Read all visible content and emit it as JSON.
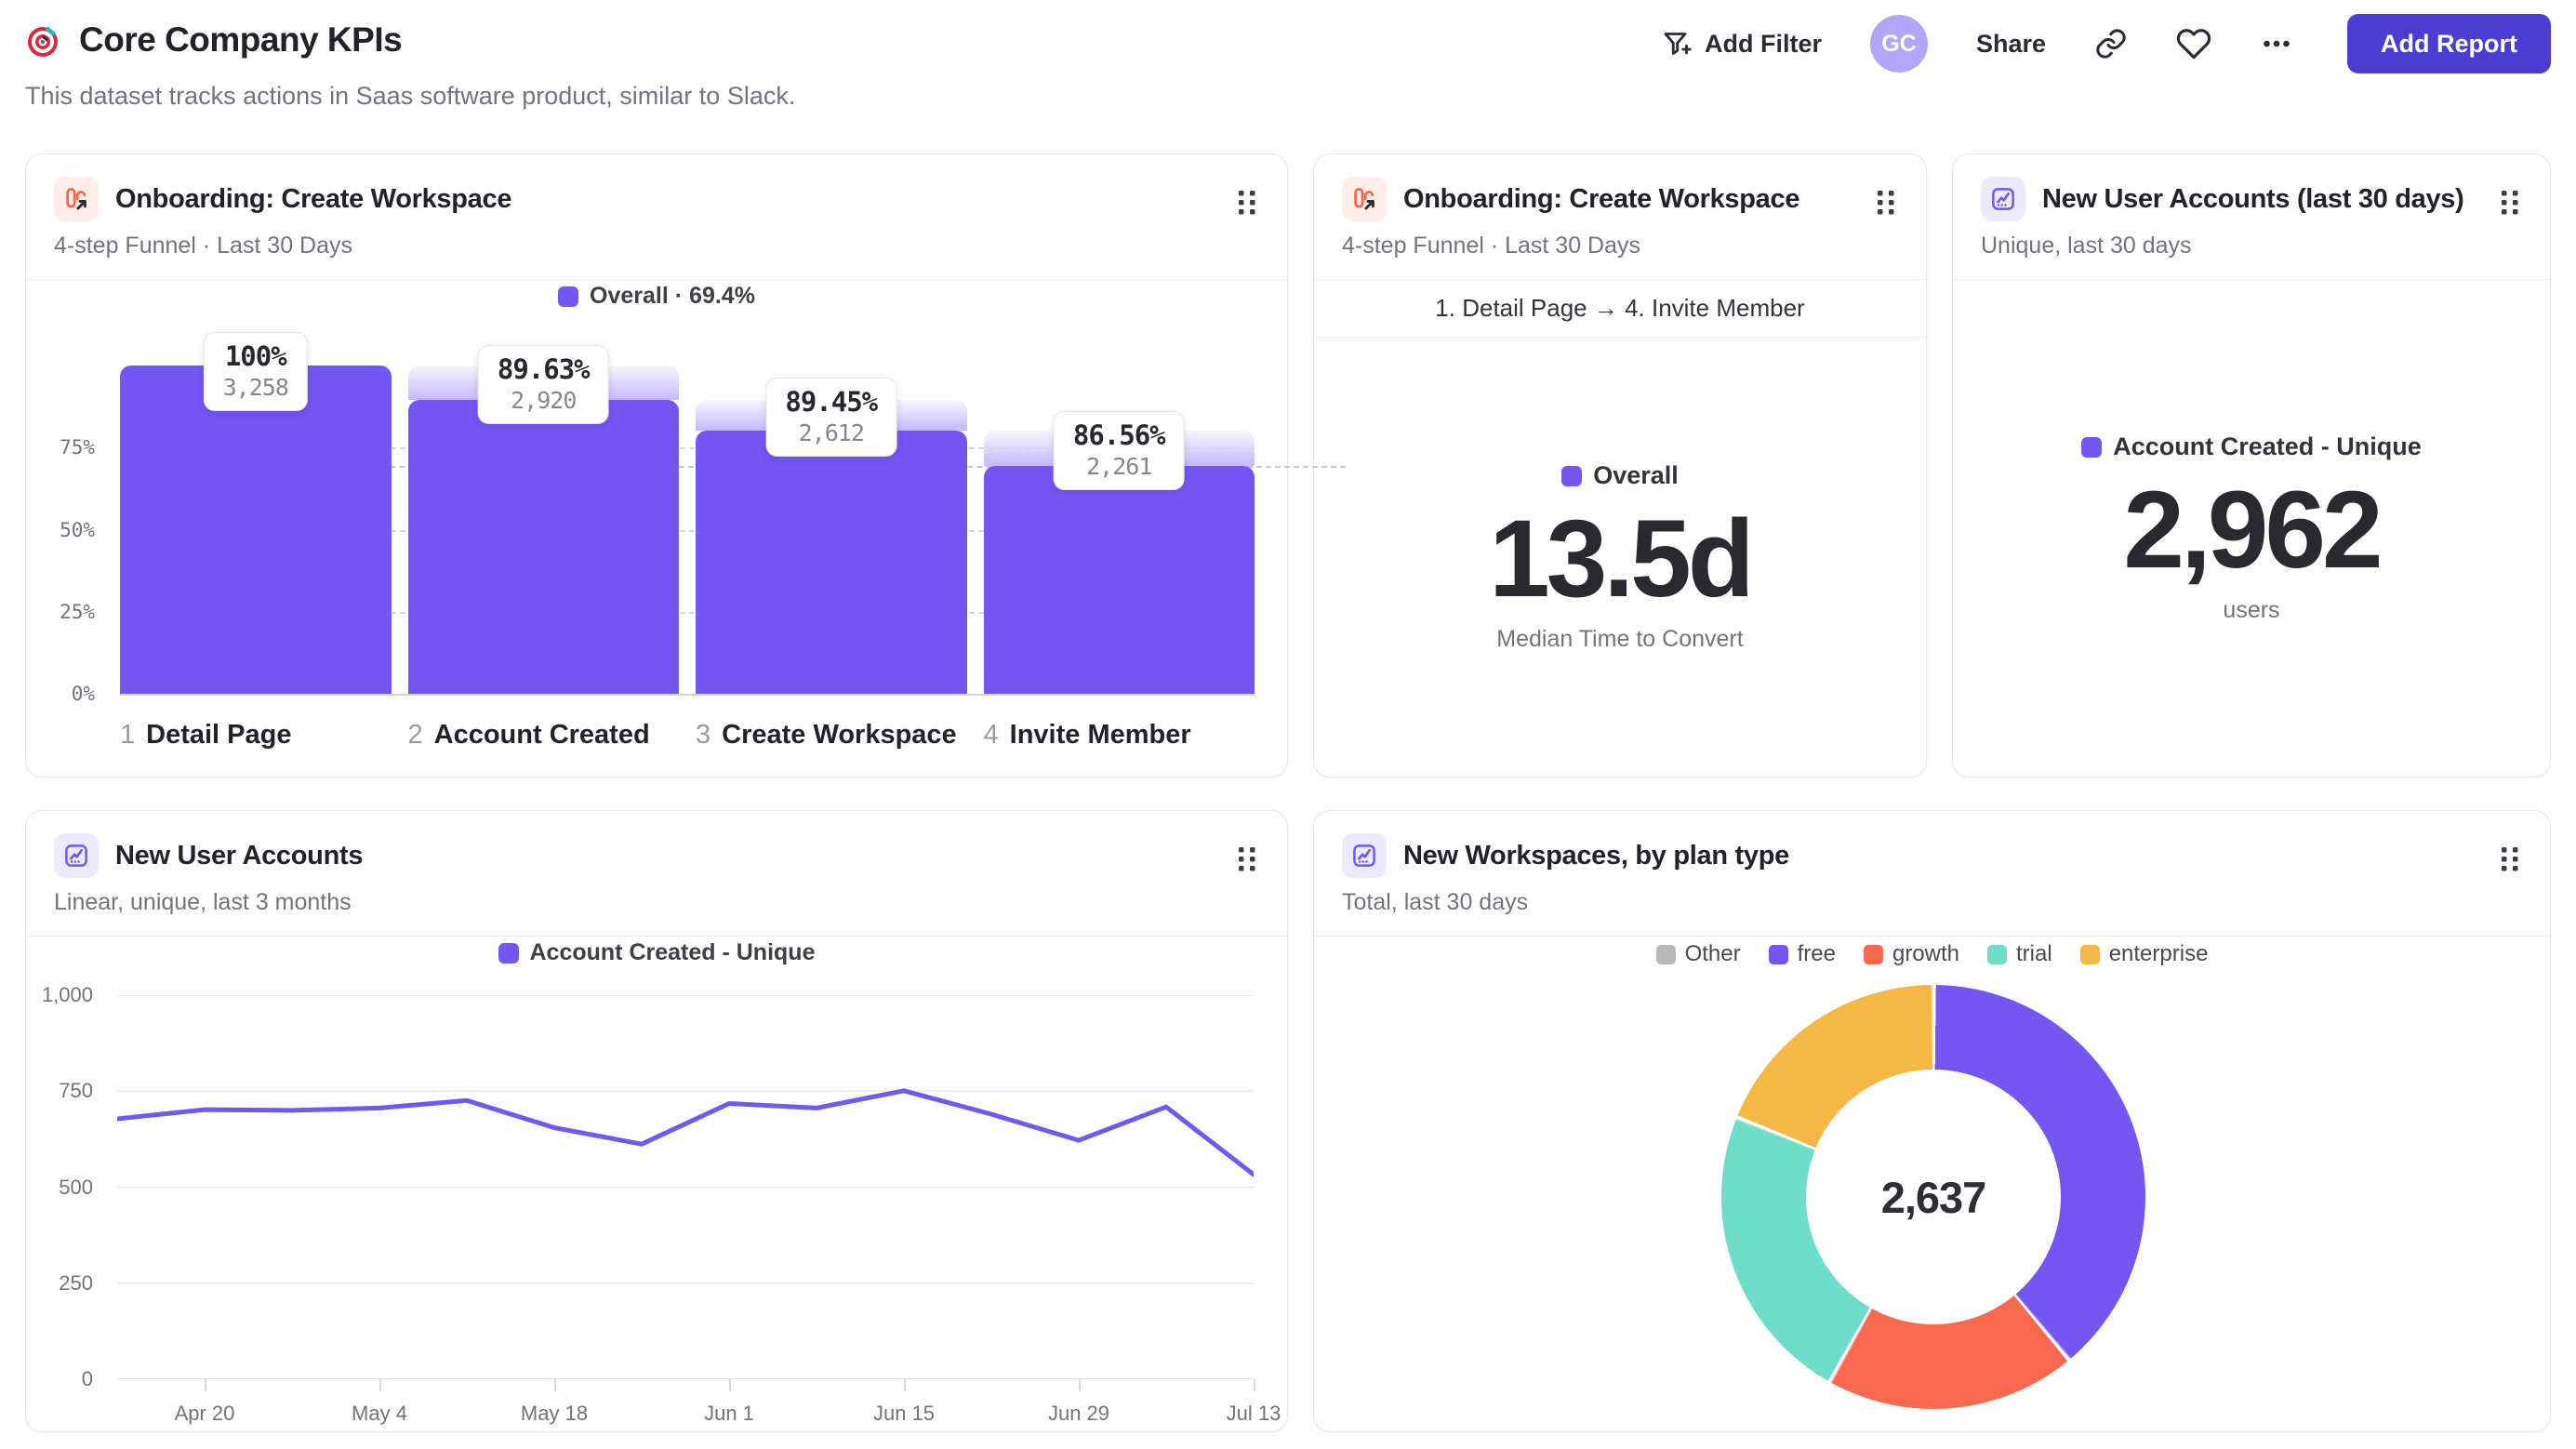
{
  "header": {
    "title": "Core Company KPIs",
    "subtitle": "This dataset tracks actions in Saas software product, similar to Slack.",
    "actions": {
      "add_filter": "Add Filter",
      "avatar_initials": "GC",
      "share": "Share",
      "add_report": "Add Report"
    }
  },
  "colors": {
    "accent_purple": "#7456f2",
    "button_indigo": "#4c3cd1",
    "avatar_purple": "#b3a6f8",
    "funnel_icon_orange": "#f2694e",
    "coral": "#f9694f",
    "teal": "#6fdec8",
    "amber": "#f6b844",
    "gray_swatch": "#b8b8b8"
  },
  "cards": [
    {
      "title": "Onboarding: Create Workspace",
      "subtitle": "4-step Funnel · Last 30 Days",
      "icon": "funnel-chart-icon"
    },
    {
      "title": "Onboarding: Create Workspace",
      "subtitle": "4-step Funnel · Last 30 Days",
      "icon": "funnel-chart-icon",
      "strip": "1. Detail Page → 4. Invite Member",
      "legend": "Overall",
      "value": "13.5d",
      "caption": "Median Time to Convert"
    },
    {
      "title": "New User Accounts (last 30 days)",
      "subtitle": "Unique, last 30 days",
      "icon": "insights-chart-icon",
      "legend": "Account Created - Unique",
      "value": "2,962",
      "caption": "users"
    },
    {
      "title": "New User Accounts",
      "subtitle": "Linear, unique, last 3 months",
      "icon": "insights-chart-icon"
    },
    {
      "title": "New Workspaces, by plan type",
      "subtitle": "Total, last 30 days",
      "icon": "insights-chart-icon"
    }
  ],
  "chart_data": [
    {
      "type": "bar",
      "subtype": "funnel",
      "title": "Onboarding: Create Workspace",
      "legend": "Overall · 69.4%",
      "overall_pct": 69.4,
      "ylim": [
        0,
        100
      ],
      "y_ticks": [
        {
          "label": "75%",
          "value": 75
        },
        {
          "label": "50%",
          "value": 50
        },
        {
          "label": "25%",
          "value": 25
        },
        {
          "label": "0%",
          "value": 0
        }
      ],
      "steps": [
        {
          "num": "1",
          "label": "Detail Page",
          "pct_label": "100%",
          "count_label": "3,258",
          "count": 3258,
          "height_pct": 100.0
        },
        {
          "num": "2",
          "label": "Account Created",
          "pct_label": "89.63%",
          "count_label": "2,920",
          "count": 2920,
          "height_pct": 89.63
        },
        {
          "num": "3",
          "label": "Create Workspace",
          "pct_label": "89.45%",
          "count_label": "2,612",
          "count": 2612,
          "height_pct": 80.17
        },
        {
          "num": "4",
          "label": "Invite Member",
          "pct_label": "86.56%",
          "count_label": "2,261",
          "count": 2261,
          "height_pct": 69.4
        }
      ]
    },
    {
      "type": "line",
      "title": "New User Accounts",
      "legend": "Account Created - Unique",
      "ylim": [
        0,
        1000
      ],
      "grid": true,
      "y_ticks": [
        {
          "label": "1,000",
          "value": 1000
        },
        {
          "label": "750",
          "value": 750
        },
        {
          "label": "500",
          "value": 500
        },
        {
          "label": "250",
          "value": 250
        },
        {
          "label": "0",
          "value": 0
        }
      ],
      "x_interval": "weekly",
      "values": [
        678,
        702,
        700,
        706,
        726,
        655,
        612,
        718,
        706,
        751,
        690,
        622,
        709,
        533
      ],
      "x_ticks": [
        {
          "label": "Apr 20",
          "index": 1
        },
        {
          "label": "May 4",
          "index": 3
        },
        {
          "label": "May 18",
          "index": 5
        },
        {
          "label": "Jun 1",
          "index": 7
        },
        {
          "label": "Jun 15",
          "index": 9
        },
        {
          "label": "Jun 29",
          "index": 11
        },
        {
          "label": "Jul 13",
          "index": 13
        }
      ]
    },
    {
      "type": "pie",
      "subtype": "donut",
      "title": "New Workspaces, by plan type",
      "center_label": "2,637",
      "total": 2637,
      "legend_position": "top",
      "slices": [
        {
          "label": "Other",
          "color": "#b8b8b8",
          "pct": 0.0
        },
        {
          "label": "free",
          "color": "#7456f2",
          "pct": 38.9
        },
        {
          "label": "growth",
          "color": "#f9694f",
          "pct": 19.2
        },
        {
          "label": "trial",
          "color": "#6fdec8",
          "pct": 23.0
        },
        {
          "label": "enterprise",
          "color": "#f6b844",
          "pct": 18.9
        }
      ]
    }
  ]
}
